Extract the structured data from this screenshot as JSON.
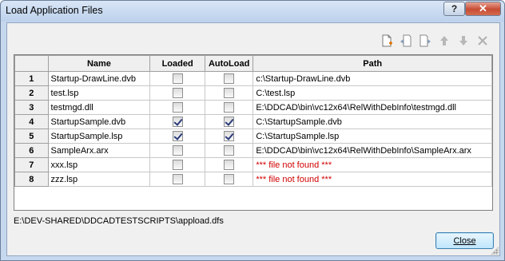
{
  "window": {
    "title": "Load Application Files",
    "help_label": "?",
    "close_label": "✕"
  },
  "toolbar": {
    "icons": [
      "new-file-icon",
      "load-before-icon",
      "load-after-icon",
      "move-up-icon",
      "move-down-icon",
      "remove-icon"
    ]
  },
  "table": {
    "columns": [
      "Name",
      "Loaded",
      "AutoLoad",
      "Path"
    ],
    "rows": [
      {
        "num": "1",
        "name": "Startup-DrawLine.dvb",
        "loaded": false,
        "autoload": false,
        "path": "c:\\Startup-DrawLine.dvb",
        "missing": false
      },
      {
        "num": "2",
        "name": "test.lsp",
        "loaded": false,
        "autoload": false,
        "path": "C:\\test.lsp",
        "missing": false
      },
      {
        "num": "3",
        "name": "testmgd.dll",
        "loaded": false,
        "autoload": false,
        "path": "E:\\DDCAD\\bin\\vc12x64\\RelWithDebInfo\\testmgd.dll",
        "missing": false
      },
      {
        "num": "4",
        "name": "StartupSample.dvb",
        "loaded": true,
        "autoload": true,
        "path": "C:\\StartupSample.dvb",
        "missing": false
      },
      {
        "num": "5",
        "name": "StartupSample.lsp",
        "loaded": true,
        "autoload": true,
        "path": "C:\\StartupSample.lsp",
        "missing": false
      },
      {
        "num": "6",
        "name": "SampleArx.arx",
        "loaded": false,
        "autoload": false,
        "path": "E:\\DDCAD\\bin\\vc12x64\\RelWithDebInfo\\SampleArx.arx",
        "missing": false
      },
      {
        "num": "7",
        "name": "xxx.lsp",
        "loaded": false,
        "autoload": false,
        "path": "*** file not found ***",
        "missing": true
      },
      {
        "num": "8",
        "name": "zzz.lsp",
        "loaded": false,
        "autoload": false,
        "path": "*** file not found ***",
        "missing": true
      }
    ]
  },
  "status": {
    "file_path": "E:\\DEV-SHARED\\DDCADTESTSCRIPTS\\appload.dfs"
  },
  "buttons": {
    "close_label": "Close"
  },
  "colors": {
    "missing": "#d00000",
    "title_bar": "#c6d8ee"
  }
}
